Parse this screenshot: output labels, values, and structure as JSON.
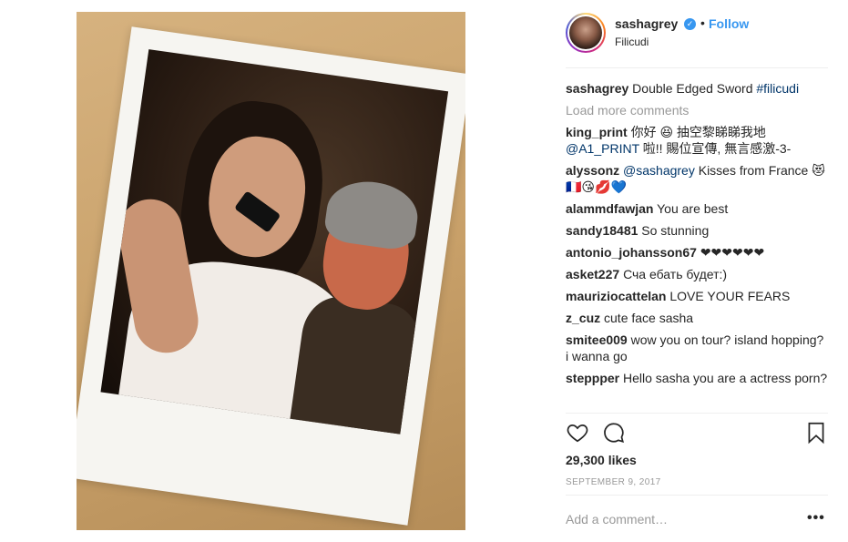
{
  "post": {
    "username": "sashagrey",
    "verified_mark": "✓",
    "separator": "•",
    "follow_label": "Follow",
    "location": "Filicudi",
    "caption": {
      "user": "sashagrey",
      "text": "Double Edged Sword ",
      "hashtag": "#filicudi"
    },
    "load_more": "Load more comments",
    "comments": [
      {
        "user": "king_print",
        "text": "你好 😆 抽空黎睇睇我地 ",
        "mention": "@A1_PRINT",
        "after": " 啦!! 賜位宣傳, 無言感激-3-"
      },
      {
        "user": "alyssonz",
        "text": "",
        "mention": "@sashagrey",
        "after": " Kisses from France 😻🇫🇷😘💋💙"
      },
      {
        "user": "alammdfawjan",
        "text": "You are best",
        "mention": "",
        "after": ""
      },
      {
        "user": "sandy18481",
        "text": "So stunning",
        "mention": "",
        "after": ""
      },
      {
        "user": "antonio_johansson67",
        "text": "❤❤❤❤❤❤",
        "mention": "",
        "after": ""
      },
      {
        "user": "asket227",
        "text": "Сча ебать будет:)",
        "mention": "",
        "after": ""
      },
      {
        "user": "mauriziocattelan",
        "text": "LOVE YOUR FEARS",
        "mention": "",
        "after": ""
      },
      {
        "user": "z_cuz",
        "text": "cute face sasha",
        "mention": "",
        "after": ""
      },
      {
        "user": "smitee009",
        "text": "wow you on tour? island hopping? i wanna go",
        "mention": "",
        "after": ""
      },
      {
        "user": "steppper",
        "text": "Hello sasha you are a actress porn?",
        "mention": "",
        "after": ""
      }
    ],
    "likes": "29,300 likes",
    "date": "SEPTEMBER 9, 2017",
    "add_comment_placeholder": "Add a comment…",
    "more_label": "•••",
    "icons": {
      "like": "heart-icon",
      "comment": "comment-bubble-icon",
      "save": "bookmark-icon"
    },
    "colors": {
      "link_blue": "#3897f0",
      "hashtag_blue": "#003569",
      "muted": "#999999"
    }
  }
}
